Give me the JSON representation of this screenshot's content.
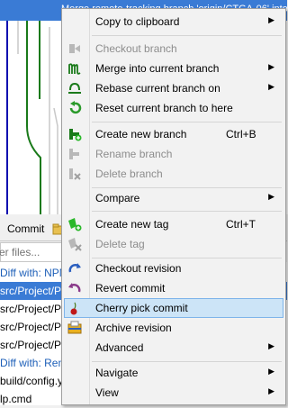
{
  "background": {
    "title_bar_text": "Merge remote-tracking branch 'origin/CTGA-06' into d",
    "tabs": [
      "Commit"
    ],
    "filter_placeholder": "er files...",
    "file_rows": [
      {
        "text": "Diff with: NPM",
        "kind": "header"
      },
      {
        "text": "src/Project/Pr",
        "kind": "selected"
      },
      {
        "text": "src/Project/Pr",
        "kind": "normal"
      },
      {
        "text": "src/Project/Pr",
        "kind": "normal"
      },
      {
        "text": "src/Project/Pr",
        "kind": "normal"
      },
      {
        "text": "Diff with: Rem",
        "kind": "header"
      },
      {
        "text": "build/config.y",
        "kind": "normal"
      },
      {
        "text": "lp.cmd",
        "kind": "normal"
      }
    ]
  },
  "menu": {
    "items": [
      {
        "label": "Copy to clipboard",
        "shortcut": "",
        "submenu": true,
        "disabled": false,
        "icon": "none-icon"
      },
      {
        "label": "Checkout branch",
        "shortcut": "",
        "submenu": false,
        "disabled": true,
        "icon": "checkout-branch-icon"
      },
      {
        "label": "Merge into current branch",
        "shortcut": "",
        "submenu": true,
        "disabled": false,
        "icon": "merge-icon"
      },
      {
        "label": "Rebase current branch on",
        "shortcut": "",
        "submenu": true,
        "disabled": false,
        "icon": "rebase-icon"
      },
      {
        "label": "Reset current branch to here",
        "shortcut": "",
        "submenu": false,
        "disabled": false,
        "icon": "reset-icon"
      },
      {
        "label": "Create new branch",
        "shortcut": "Ctrl+B",
        "submenu": false,
        "disabled": false,
        "icon": "new-branch-icon"
      },
      {
        "label": "Rename branch",
        "shortcut": "",
        "submenu": false,
        "disabled": true,
        "icon": "rename-branch-icon"
      },
      {
        "label": "Delete branch",
        "shortcut": "",
        "submenu": false,
        "disabled": true,
        "icon": "delete-branch-icon"
      },
      {
        "label": "Compare",
        "shortcut": "",
        "submenu": true,
        "disabled": false,
        "icon": "none-icon"
      },
      {
        "label": "Create new tag",
        "shortcut": "Ctrl+T",
        "submenu": false,
        "disabled": false,
        "icon": "new-tag-icon"
      },
      {
        "label": "Delete tag",
        "shortcut": "",
        "submenu": false,
        "disabled": true,
        "icon": "delete-tag-icon"
      },
      {
        "label": "Checkout revision",
        "shortcut": "",
        "submenu": false,
        "disabled": false,
        "icon": "checkout-revision-icon"
      },
      {
        "label": "Revert commit",
        "shortcut": "",
        "submenu": false,
        "disabled": false,
        "icon": "revert-commit-icon"
      },
      {
        "label": "Cherry pick commit",
        "shortcut": "",
        "submenu": false,
        "disabled": false,
        "icon": "cherry-icon",
        "highlighted": true
      },
      {
        "label": "Archive revision",
        "shortcut": "",
        "submenu": false,
        "disabled": false,
        "icon": "archive-icon"
      },
      {
        "label": "Advanced",
        "shortcut": "",
        "submenu": true,
        "disabled": false,
        "icon": "none-icon"
      },
      {
        "label": "Navigate",
        "shortcut": "",
        "submenu": true,
        "disabled": false,
        "icon": "none-icon"
      },
      {
        "label": "View",
        "shortcut": "",
        "submenu": true,
        "disabled": false,
        "icon": "none-icon"
      }
    ]
  },
  "colors": {
    "selection_blue": "#3a7bd5",
    "menu_highlight": "#cce4f7",
    "branch_green": "#1a7a1a",
    "branch_blue": "#1010b0"
  }
}
